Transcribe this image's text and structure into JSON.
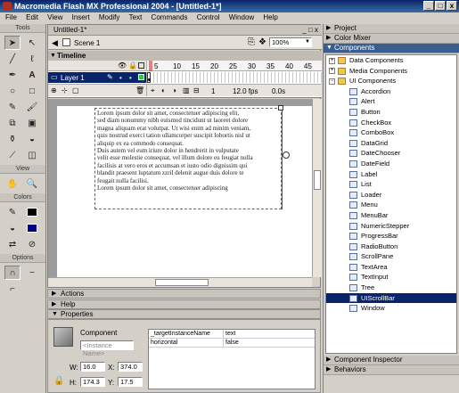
{
  "window": {
    "title": "Macromedia Flash MX Professional 2004 - [Untitled-1*]",
    "min": "_",
    "max": "□",
    "close": "x"
  },
  "menu": [
    "File",
    "Edit",
    "View",
    "Insert",
    "Modify",
    "Text",
    "Commands",
    "Control",
    "Window",
    "Help"
  ],
  "tools": {
    "title": "Tools",
    "view_title": "View",
    "colors_title": "Colors",
    "options_title": "Options"
  },
  "document": {
    "tab": "Untitled-1*",
    "scene": "Scene 1",
    "zoom": "100%",
    "timeline_title": "Timeline",
    "layer_name": "Layer 1",
    "frame_numbers": [
      "5",
      "10",
      "15",
      "20",
      "25",
      "30",
      "35",
      "40",
      "45"
    ],
    "frame_index": "1",
    "fps": "12.0 fps",
    "elapsed": "0.0s",
    "text_lines": [
      "Lorem ipsum dolor sit amet, consectetuer adipiscing elit,",
      "sed diam nonummy nibh euismod tincidunt ut laoreet dolore",
      "magna aliquam erat volutpat. Ut wisi enim ad minim veniam,",
      "quis nostrud exerci tation ullamcorper suscipit lobortis nisl ut",
      "aliquip ex ea commodo consequat.",
      "Duis autem vel eum iriure dolor in hendrerit in vulputate",
      "velit esse molestie consequat, vel illum dolore eu feugiat nulla",
      "facilisis at vero eros et accumsan et iusto odio dignissim qui",
      "blandit praesent luptatum zzril delenit augue duis dolore te",
      "feugait nulla facilisi.",
      "Lorem ipsum dolor sit amet, consectetuer adipiscing"
    ]
  },
  "panels": {
    "actions": "Actions",
    "help": "Help",
    "properties": "Properties"
  },
  "properties": {
    "type": "Component",
    "instance_placeholder": "<Instance Name>",
    "w_label": "W:",
    "w": "16.0",
    "h_label": "H:",
    "h": "174.3",
    "x_label": "X:",
    "x": "374.0",
    "y_label": "Y:",
    "y": "17.5",
    "params": [
      [
        "_targetInstanceName",
        "text"
      ],
      [
        "horizontal",
        "false"
      ]
    ]
  },
  "right": {
    "project": "Project",
    "color_mixer": "Color Mixer",
    "components": "Components",
    "component_inspector": "Component Inspector",
    "behaviors": "Behaviors",
    "folders": [
      "Data Components",
      "Media Components",
      "UI Components"
    ],
    "items": [
      "Accordion",
      "Alert",
      "Button",
      "CheckBox",
      "ComboBox",
      "DataGrid",
      "DateChooser",
      "DateField",
      "Label",
      "List",
      "Loader",
      "Menu",
      "MenuBar",
      "NumericStepper",
      "ProgressBar",
      "RadioButton",
      "ScrollPane",
      "TextArea",
      "TextInput",
      "Tree",
      "UIScrollBar",
      "Window"
    ],
    "selected": "UIScrollBar"
  },
  "colors": {
    "titlebar": "#0a246a",
    "selection": "#0a246a",
    "layer_highlight": "#0a246a"
  }
}
